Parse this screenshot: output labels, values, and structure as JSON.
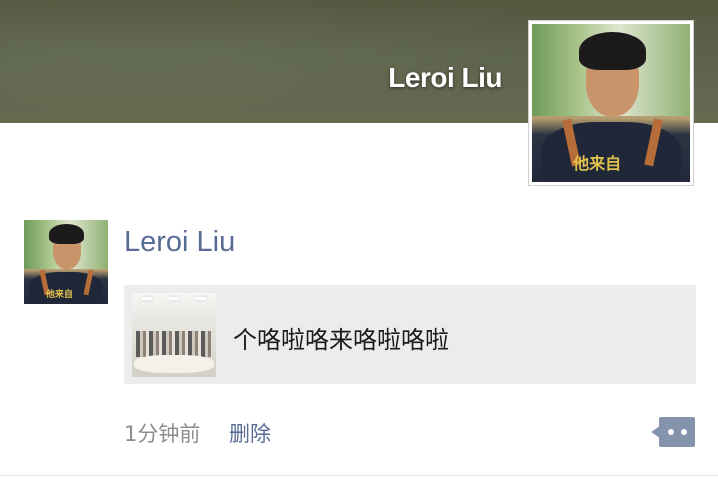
{
  "cover": {
    "user_name": "Leroi Liu",
    "avatar_shirt_text": "他来自"
  },
  "post": {
    "author": "Leroi Liu",
    "avatar_shirt_text": "他来自",
    "link_card": {
      "title": "个咯啦咯来咯啦咯啦"
    },
    "time": "1分钟前",
    "delete_label": "删除"
  },
  "colors": {
    "link_blue": "#576b95",
    "card_bg": "#ececec",
    "more_button": "#8593ad"
  },
  "icons": {
    "more": "comment-dots-icon"
  }
}
